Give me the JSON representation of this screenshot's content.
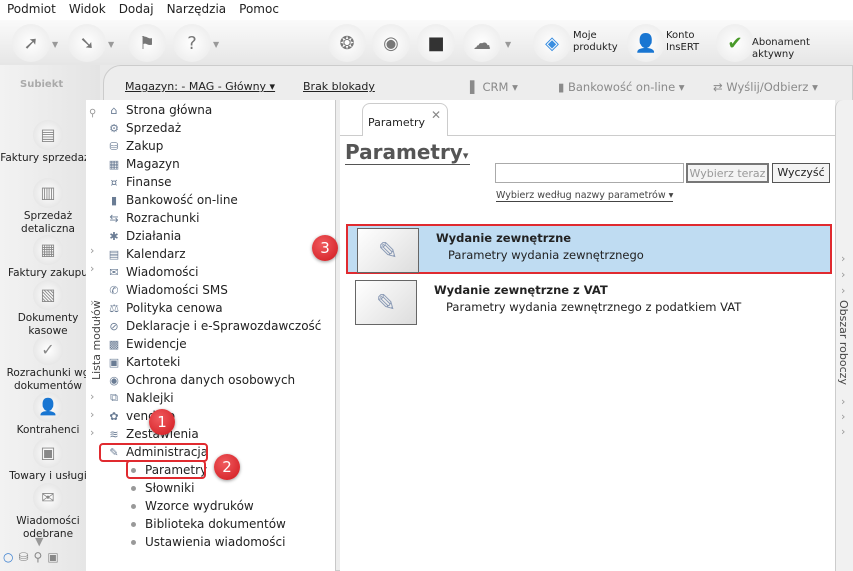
{
  "menu": [
    "Podmiot",
    "Widok",
    "Dodaj",
    "Narzędzia",
    "Pomoc"
  ],
  "toolbar": {
    "moje_produkty": "Moje produkty",
    "konto": "Konto InsERT",
    "abonament": "Abonament aktywny",
    "insert_logo": "InsERT"
  },
  "logo": "Subiekt",
  "sidebar": [
    "Faktury sprzedaży",
    "Sprzedaż detaliczna",
    "Faktury zakupu",
    "Dokumenty kasowe",
    "Rozrachunki wg dokumentów",
    "Kontrahenci",
    "Towary i usługi",
    "Wiadomości odebrane"
  ],
  "topbar": {
    "magazyn": "Magazyn: - MAG - Główny",
    "blokada": "Brak blokady",
    "crm": "CRM",
    "bank": "Bankowość on-line",
    "wyslij": "Wyślij/Odbierz"
  },
  "modules": {
    "label": "Lista modułów",
    "items": [
      "Strona główna",
      "Sprzedaż",
      "Zakup",
      "Magazyn",
      "Finanse",
      "Bankowość on-line",
      "Rozrachunki",
      "Działania",
      "Kalendarz",
      "Wiadomości",
      "Wiadomości SMS",
      "Polityka cenowa",
      "Deklaracje i e-Sprawozdawczość",
      "Ewidencje",
      "Kartoteki",
      "Ochrona danych osobowych",
      "Naklejki",
      "vendero",
      "Zestawienia",
      "Administracja"
    ],
    "sub": [
      "Parametry",
      "Słowniki",
      "Wzorce wydruków",
      "Biblioteka dokumentów",
      "Ustawienia wiadomości"
    ]
  },
  "content": {
    "tab": "Parametry",
    "title": "Parametry",
    "search_value": "",
    "btn_select": "Wybierz teraz",
    "btn_clear": "Wyczyść",
    "filter": "Wybierz według nazwy parametrów",
    "rows": [
      {
        "title": "Wydanie zewnętrzne",
        "desc": "Parametry wydania zewnętrznego"
      },
      {
        "title": "Wydanie zewnętrzne z VAT",
        "desc": "Parametry wydania zewnętrznego z podatkiem VAT"
      }
    ]
  },
  "right_panel": "Obszar roboczy",
  "badges": [
    "1",
    "2",
    "3"
  ],
  "colors": {
    "highlight": "#e02a2f",
    "selected_row": "#bfdcf2"
  }
}
